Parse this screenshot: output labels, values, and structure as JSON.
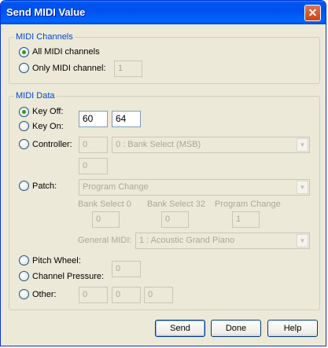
{
  "window": {
    "title": "Send MIDI Value",
    "close_glyph": "✕"
  },
  "channels": {
    "legend": "MIDI Channels",
    "all_label": "All MIDI channels",
    "only_label": "Only MIDI channel:",
    "channel_value": "1"
  },
  "data": {
    "legend": "MIDI Data",
    "key_off_label": "Key Off:",
    "key_on_label": "Key On:",
    "key_value_1": "60",
    "key_value_2": "64",
    "controller_label": "Controller:",
    "controller_value": "0",
    "controller_select": "0 : Bank Select (MSB)",
    "controller_value_2": "0",
    "patch_label": "Patch:",
    "patch_select": "Program Change",
    "bank_select_0_label": "Bank Select 0",
    "bank_select_32_label": "Bank Select 32",
    "program_change_label": "Program Change",
    "bank0_value": "0",
    "bank32_value": "0",
    "program_value": "1",
    "general_midi_label": "General MIDI:",
    "general_midi_select": "1 : Acoustic Grand Piano",
    "pitch_wheel_label": "Pitch Wheel:",
    "channel_pressure_label": "Channel Pressure:",
    "pressure_value": "0",
    "other_label": "Other:",
    "other_1": "0",
    "other_2": "0",
    "other_3": "0"
  },
  "buttons": {
    "send": "Send",
    "done": "Done",
    "help": "Help"
  }
}
